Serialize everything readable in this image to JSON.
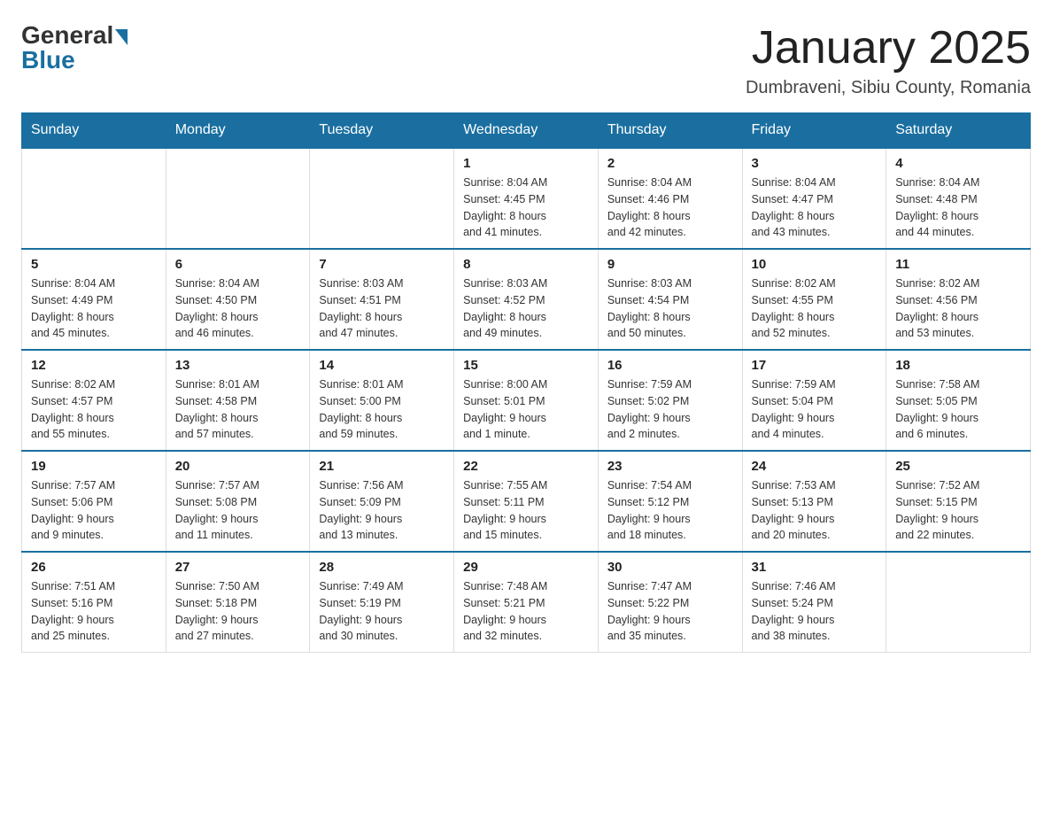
{
  "logo": {
    "general": "General",
    "blue": "Blue"
  },
  "header": {
    "title": "January 2025",
    "location": "Dumbraveni, Sibiu County, Romania"
  },
  "weekdays": [
    "Sunday",
    "Monday",
    "Tuesday",
    "Wednesday",
    "Thursday",
    "Friday",
    "Saturday"
  ],
  "weeks": [
    [
      {
        "day": "",
        "info": ""
      },
      {
        "day": "",
        "info": ""
      },
      {
        "day": "",
        "info": ""
      },
      {
        "day": "1",
        "info": "Sunrise: 8:04 AM\nSunset: 4:45 PM\nDaylight: 8 hours\nand 41 minutes."
      },
      {
        "day": "2",
        "info": "Sunrise: 8:04 AM\nSunset: 4:46 PM\nDaylight: 8 hours\nand 42 minutes."
      },
      {
        "day": "3",
        "info": "Sunrise: 8:04 AM\nSunset: 4:47 PM\nDaylight: 8 hours\nand 43 minutes."
      },
      {
        "day": "4",
        "info": "Sunrise: 8:04 AM\nSunset: 4:48 PM\nDaylight: 8 hours\nand 44 minutes."
      }
    ],
    [
      {
        "day": "5",
        "info": "Sunrise: 8:04 AM\nSunset: 4:49 PM\nDaylight: 8 hours\nand 45 minutes."
      },
      {
        "day": "6",
        "info": "Sunrise: 8:04 AM\nSunset: 4:50 PM\nDaylight: 8 hours\nand 46 minutes."
      },
      {
        "day": "7",
        "info": "Sunrise: 8:03 AM\nSunset: 4:51 PM\nDaylight: 8 hours\nand 47 minutes."
      },
      {
        "day": "8",
        "info": "Sunrise: 8:03 AM\nSunset: 4:52 PM\nDaylight: 8 hours\nand 49 minutes."
      },
      {
        "day": "9",
        "info": "Sunrise: 8:03 AM\nSunset: 4:54 PM\nDaylight: 8 hours\nand 50 minutes."
      },
      {
        "day": "10",
        "info": "Sunrise: 8:02 AM\nSunset: 4:55 PM\nDaylight: 8 hours\nand 52 minutes."
      },
      {
        "day": "11",
        "info": "Sunrise: 8:02 AM\nSunset: 4:56 PM\nDaylight: 8 hours\nand 53 minutes."
      }
    ],
    [
      {
        "day": "12",
        "info": "Sunrise: 8:02 AM\nSunset: 4:57 PM\nDaylight: 8 hours\nand 55 minutes."
      },
      {
        "day": "13",
        "info": "Sunrise: 8:01 AM\nSunset: 4:58 PM\nDaylight: 8 hours\nand 57 minutes."
      },
      {
        "day": "14",
        "info": "Sunrise: 8:01 AM\nSunset: 5:00 PM\nDaylight: 8 hours\nand 59 minutes."
      },
      {
        "day": "15",
        "info": "Sunrise: 8:00 AM\nSunset: 5:01 PM\nDaylight: 9 hours\nand 1 minute."
      },
      {
        "day": "16",
        "info": "Sunrise: 7:59 AM\nSunset: 5:02 PM\nDaylight: 9 hours\nand 2 minutes."
      },
      {
        "day": "17",
        "info": "Sunrise: 7:59 AM\nSunset: 5:04 PM\nDaylight: 9 hours\nand 4 minutes."
      },
      {
        "day": "18",
        "info": "Sunrise: 7:58 AM\nSunset: 5:05 PM\nDaylight: 9 hours\nand 6 minutes."
      }
    ],
    [
      {
        "day": "19",
        "info": "Sunrise: 7:57 AM\nSunset: 5:06 PM\nDaylight: 9 hours\nand 9 minutes."
      },
      {
        "day": "20",
        "info": "Sunrise: 7:57 AM\nSunset: 5:08 PM\nDaylight: 9 hours\nand 11 minutes."
      },
      {
        "day": "21",
        "info": "Sunrise: 7:56 AM\nSunset: 5:09 PM\nDaylight: 9 hours\nand 13 minutes."
      },
      {
        "day": "22",
        "info": "Sunrise: 7:55 AM\nSunset: 5:11 PM\nDaylight: 9 hours\nand 15 minutes."
      },
      {
        "day": "23",
        "info": "Sunrise: 7:54 AM\nSunset: 5:12 PM\nDaylight: 9 hours\nand 18 minutes."
      },
      {
        "day": "24",
        "info": "Sunrise: 7:53 AM\nSunset: 5:13 PM\nDaylight: 9 hours\nand 20 minutes."
      },
      {
        "day": "25",
        "info": "Sunrise: 7:52 AM\nSunset: 5:15 PM\nDaylight: 9 hours\nand 22 minutes."
      }
    ],
    [
      {
        "day": "26",
        "info": "Sunrise: 7:51 AM\nSunset: 5:16 PM\nDaylight: 9 hours\nand 25 minutes."
      },
      {
        "day": "27",
        "info": "Sunrise: 7:50 AM\nSunset: 5:18 PM\nDaylight: 9 hours\nand 27 minutes."
      },
      {
        "day": "28",
        "info": "Sunrise: 7:49 AM\nSunset: 5:19 PM\nDaylight: 9 hours\nand 30 minutes."
      },
      {
        "day": "29",
        "info": "Sunrise: 7:48 AM\nSunset: 5:21 PM\nDaylight: 9 hours\nand 32 minutes."
      },
      {
        "day": "30",
        "info": "Sunrise: 7:47 AM\nSunset: 5:22 PM\nDaylight: 9 hours\nand 35 minutes."
      },
      {
        "day": "31",
        "info": "Sunrise: 7:46 AM\nSunset: 5:24 PM\nDaylight: 9 hours\nand 38 minutes."
      },
      {
        "day": "",
        "info": ""
      }
    ]
  ]
}
